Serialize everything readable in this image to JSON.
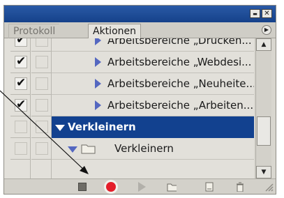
{
  "tabs": [
    {
      "label": "Protokoll",
      "active": false
    },
    {
      "label": "Aktionen",
      "active": true
    }
  ],
  "window_buttons": {
    "minimize": "▬",
    "close": "✕"
  },
  "flyout_menu_icon": "flyout-menu-icon",
  "rows": [
    {
      "label": "Arbeitsbereiche „Drucken...",
      "checked": true,
      "expanded": false,
      "kind": "action"
    },
    {
      "label": "Arbeitsbereiche „Webdesi...",
      "checked": true,
      "expanded": false,
      "kind": "action"
    },
    {
      "label": "Arbeitsbereiche „Neuheite...",
      "checked": true,
      "expanded": false,
      "kind": "action"
    },
    {
      "label": "Arbeitsbereiche „Arbeiten...",
      "checked": true,
      "expanded": false,
      "kind": "action"
    },
    {
      "label": "Verkleinern",
      "checked": false,
      "expanded": true,
      "kind": "action",
      "selected": true
    },
    {
      "label": "Verkleinern",
      "checked": false,
      "expanded": true,
      "kind": "set"
    }
  ],
  "toolbar": [
    {
      "name": "stop-icon",
      "glyph": "■"
    },
    {
      "name": "record-icon",
      "glyph": "●"
    },
    {
      "name": "play-icon",
      "glyph": "▶"
    },
    {
      "name": "new-set-icon",
      "glyph": "folder"
    },
    {
      "name": "new-action-icon",
      "glyph": "page"
    },
    {
      "name": "delete-icon",
      "glyph": "trash"
    }
  ],
  "colors": {
    "title_bar": "#15418a",
    "selection": "#12418f",
    "record": "#e41e2a",
    "expand_triangle": "#5467c0"
  }
}
